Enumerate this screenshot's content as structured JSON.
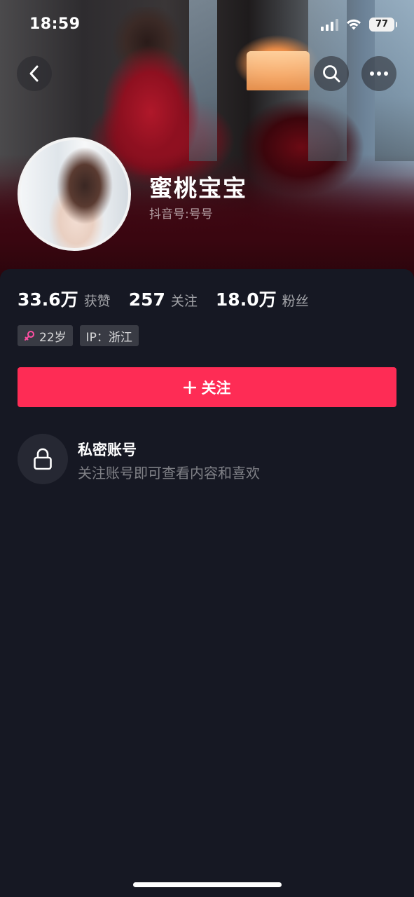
{
  "status_bar": {
    "time": "18:59",
    "battery": "77"
  },
  "nav": {
    "back_icon": "chevron-left-icon",
    "search_icon": "search-icon",
    "more_icon": "more-horizontal-icon"
  },
  "profile": {
    "name": "蜜桃宝宝",
    "douyin_id": "抖音号:号号"
  },
  "stats": [
    {
      "value": "33.6万",
      "label": "获赞"
    },
    {
      "value": "257",
      "label": "关注"
    },
    {
      "value": "18.0万",
      "label": "粉丝"
    }
  ],
  "tags": {
    "age": "22岁",
    "ip": "IP：浙江"
  },
  "follow_button": {
    "label": "关注",
    "icon": "plus-icon"
  },
  "private_account": {
    "title": "私密账号",
    "subtitle": "关注账号即可查看内容和喜欢",
    "icon": "lock-icon"
  },
  "colors": {
    "background": "#161823",
    "accent": "#fe2c55",
    "tag_bg": "#393b44",
    "female_symbol": "#ff4fa3"
  }
}
